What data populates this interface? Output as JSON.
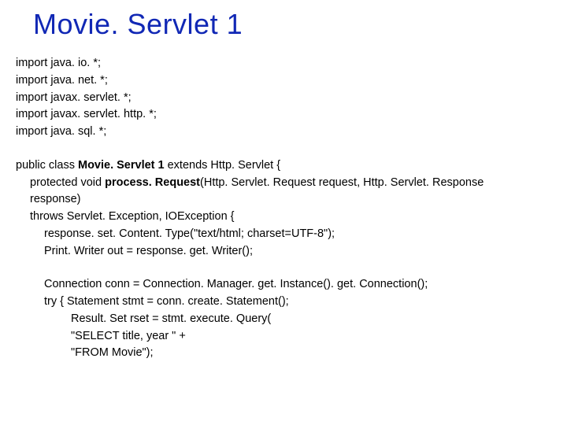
{
  "title": "Movie. Servlet 1",
  "imports": [
    "import java. io. *;",
    "import java. net. *;",
    "import javax. servlet. *;",
    "import javax. servlet. http. *;",
    "import java. sql. *;"
  ],
  "class_decl": {
    "pre": "public class ",
    "name": "Movie. Servlet 1",
    "post": " extends Http. Servlet {"
  },
  "method_decl": {
    "pre": "protected void ",
    "name": "process. Request",
    "post": "(Http. Servlet. Request request, Http. Servlet. Response"
  },
  "lines": {
    "response_close": "response)",
    "throws": "throws Servlet. Exception, IOException {",
    "setContent": "response. set. Content. Type(\"text/html; charset=UTF-8\");",
    "writer": "Print. Writer out = response. get. Writer();",
    "conn": "Connection conn = Connection. Manager. get. Instance(). get. Connection();",
    "try_stmt": "try { Statement stmt = conn. create. Statement();",
    "rset": "Result. Set rset = stmt. execute. Query(",
    "select": "\"SELECT title, year \" +",
    "from": "\"FROM Movie\");"
  }
}
